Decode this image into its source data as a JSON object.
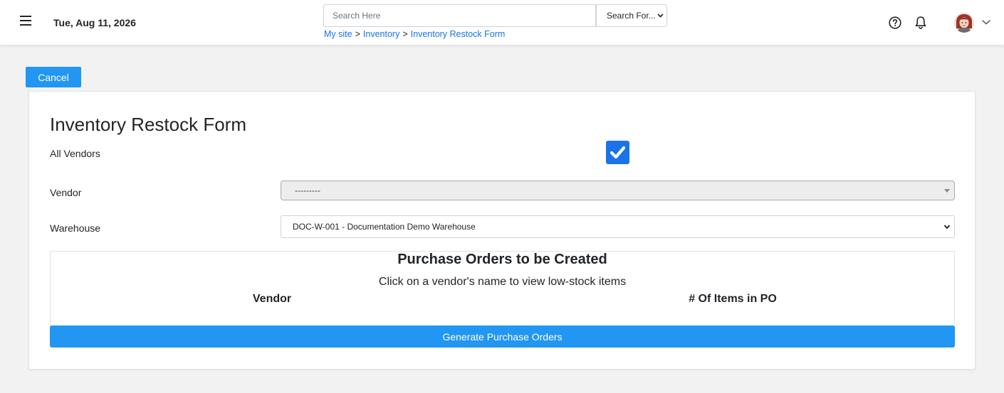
{
  "header": {
    "date": "Tue, Aug 11, 2026",
    "search": {
      "placeholder": "Search Here",
      "value": ""
    },
    "search_for": {
      "selected": "Search For..."
    },
    "breadcrumb": [
      {
        "label": "My site"
      },
      {
        "label": "Inventory"
      },
      {
        "label": "Inventory Restock Form"
      }
    ],
    "separator": ">",
    "icons": [
      "menu-icon",
      "help-icon",
      "bell-icon",
      "avatar",
      "chevron-down-icon"
    ]
  },
  "actions": {
    "cancel_label": "Cancel"
  },
  "form": {
    "title": "Inventory Restock Form",
    "all_vendors_label": "All Vendors",
    "all_vendors_checked": true,
    "vendor_label": "Vendor",
    "vendor_value": "---------",
    "warehouse_label": "Warehouse",
    "warehouse_value": "DOC-W-001 - Documentation Demo Warehouse"
  },
  "purchase_orders": {
    "title": "Purchase Orders to be Created",
    "subtitle": "Click on a vendor's name to view low-stock items",
    "columns": [
      "Vendor",
      "# Of Items in PO"
    ]
  },
  "generate_label": "Generate Purchase Orders",
  "colors": {
    "accent": "#2196f3",
    "checkbox": "#1a73e8",
    "link": "#1a73e8"
  }
}
